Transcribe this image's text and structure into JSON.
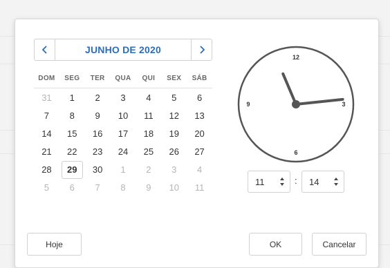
{
  "calendar": {
    "month_title": "JUNHO DE 2020",
    "weekdays": [
      "DOM",
      "SEG",
      "TER",
      "QUA",
      "QUI",
      "SEX",
      "SÁB"
    ],
    "weeks": [
      [
        {
          "d": "31",
          "muted": true
        },
        {
          "d": "1"
        },
        {
          "d": "2"
        },
        {
          "d": "3"
        },
        {
          "d": "4"
        },
        {
          "d": "5"
        },
        {
          "d": "6"
        }
      ],
      [
        {
          "d": "7"
        },
        {
          "d": "8"
        },
        {
          "d": "9"
        },
        {
          "d": "10"
        },
        {
          "d": "11"
        },
        {
          "d": "12"
        },
        {
          "d": "13"
        }
      ],
      [
        {
          "d": "14"
        },
        {
          "d": "15"
        },
        {
          "d": "16"
        },
        {
          "d": "17"
        },
        {
          "d": "18"
        },
        {
          "d": "19"
        },
        {
          "d": "20"
        }
      ],
      [
        {
          "d": "21"
        },
        {
          "d": "22"
        },
        {
          "d": "23"
        },
        {
          "d": "24"
        },
        {
          "d": "25"
        },
        {
          "d": "26"
        },
        {
          "d": "27"
        }
      ],
      [
        {
          "d": "28"
        },
        {
          "d": "29",
          "today": true
        },
        {
          "d": "30"
        },
        {
          "d": "1",
          "muted": true
        },
        {
          "d": "2",
          "muted": true
        },
        {
          "d": "3",
          "muted": true
        },
        {
          "d": "4",
          "muted": true
        }
      ],
      [
        {
          "d": "5",
          "muted": true
        },
        {
          "d": "6",
          "muted": true
        },
        {
          "d": "7",
          "muted": true
        },
        {
          "d": "8",
          "muted": true
        },
        {
          "d": "9",
          "muted": true
        },
        {
          "d": "10",
          "muted": true
        },
        {
          "d": "11",
          "muted": true
        }
      ]
    ]
  },
  "clock": {
    "labels": {
      "top": "12",
      "right": "3",
      "bottom": "6",
      "left": "9"
    },
    "hour": 11,
    "minute": 14
  },
  "time": {
    "hour": "11",
    "separator": ":",
    "minute": "14"
  },
  "buttons": {
    "today": "Hoje",
    "ok": "OK",
    "cancel": "Cancelar"
  },
  "colors": {
    "accent": "#2d6db5",
    "clock_stroke": "#555555"
  }
}
